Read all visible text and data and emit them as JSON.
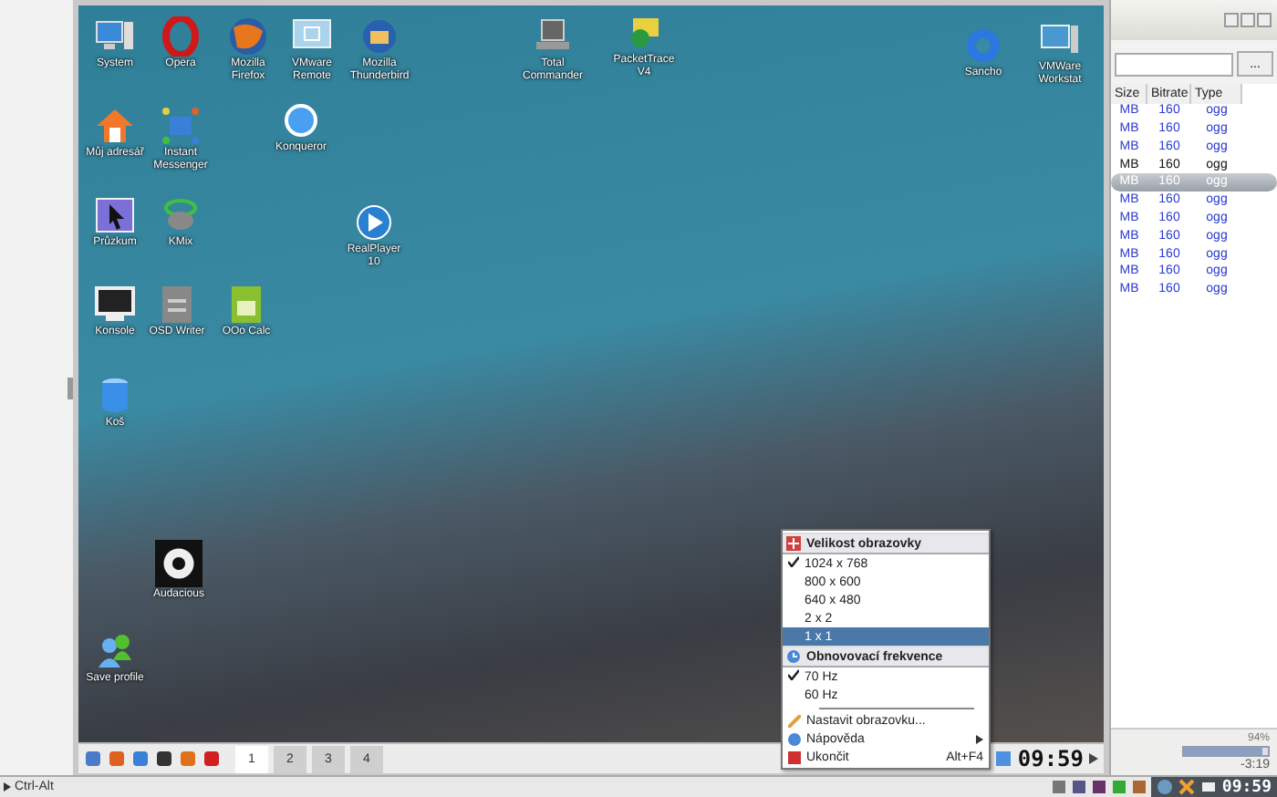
{
  "desktop": {
    "icons": [
      {
        "label": "System"
      },
      {
        "label": "Opera"
      },
      {
        "label": "Mozilla Firefox"
      },
      {
        "label": "VMware Remote"
      },
      {
        "label": "Mozilla Thunderbird"
      },
      {
        "label": "Total Commander"
      },
      {
        "label": "PacketTrace V4"
      },
      {
        "label": "Sancho"
      },
      {
        "label": "VMWare Workstat"
      },
      {
        "label": "Můj adresář"
      },
      {
        "label": "Instant Messenger"
      },
      {
        "label": "Konqueror"
      },
      {
        "label": "Průzkum"
      },
      {
        "label": "KMix"
      },
      {
        "label": "RealPlayer 10"
      },
      {
        "label": "Konsole"
      },
      {
        "label": "OSD Writer"
      },
      {
        "label": "OOo Calc"
      },
      {
        "label": "Koš"
      },
      {
        "label": "Audacious"
      },
      {
        "label": "Save profile"
      }
    ]
  },
  "menu": {
    "sections": [
      {
        "title": "Velikost obrazovky",
        "items": [
          {
            "label": "1024 x 768",
            "checked": true,
            "selected": false
          },
          {
            "label": "800 x 600",
            "checked": false,
            "selected": false
          },
          {
            "label": "640 x 480",
            "checked": false,
            "selected": false
          },
          {
            "label": "2 x 2",
            "checked": false,
            "selected": false
          },
          {
            "label": "1 x 1",
            "checked": false,
            "selected": true
          }
        ]
      },
      {
        "title": "Obnovovací frekvence",
        "items": [
          {
            "label": "70 Hz",
            "checked": true,
            "selected": false
          },
          {
            "label": "60 Hz",
            "checked": false,
            "selected": false
          }
        ]
      }
    ],
    "actions": [
      {
        "label": "Nastavit obrazovku...",
        "submenu": false
      },
      {
        "label": "Nápověda",
        "submenu": true
      },
      {
        "label": "Ukončit",
        "shortcut": "Alt+F4",
        "submenu": false
      }
    ]
  },
  "taskbar": {
    "desktops": [
      {
        "label": "1",
        "selected": true
      },
      {
        "label": "2",
        "selected": false
      },
      {
        "label": "3",
        "selected": false
      },
      {
        "label": "4",
        "selected": false
      }
    ],
    "clock": "09:59"
  },
  "player": {
    "browse_button": "...",
    "table": {
      "columns": [
        "Size",
        "Bitrate",
        "Type"
      ],
      "rows": [
        {
          "cells": [
            "MB",
            "160",
            "ogg"
          ],
          "selected": false,
          "playing": false
        },
        {
          "cells": [
            "MB",
            "160",
            "ogg"
          ],
          "selected": false,
          "playing": false
        },
        {
          "cells": [
            "MB",
            "160",
            "ogg"
          ],
          "selected": false,
          "playing": false
        },
        {
          "cells": [
            "MB",
            "160",
            "ogg"
          ],
          "selected": false,
          "playing": true
        },
        {
          "cells": [
            "MB",
            "160",
            "ogg"
          ],
          "selected": true,
          "playing": false
        },
        {
          "cells": [
            "MB",
            "160",
            "ogg"
          ],
          "selected": false,
          "playing": false
        },
        {
          "cells": [
            "MB",
            "160",
            "ogg"
          ],
          "selected": false,
          "playing": false
        },
        {
          "cells": [
            "MB",
            "160",
            "ogg"
          ],
          "selected": false,
          "playing": false
        },
        {
          "cells": [
            "MB",
            "160",
            "ogg"
          ],
          "selected": false,
          "playing": false
        },
        {
          "cells": [
            "MB",
            "160",
            "ogg"
          ],
          "selected": false,
          "playing": false
        },
        {
          "cells": [
            "MB",
            "160",
            "ogg"
          ],
          "selected": false,
          "playing": false
        }
      ]
    },
    "volume": {
      "reading": "94%",
      "level": 0.94
    },
    "time": "-3:19"
  },
  "host_bar": {
    "hint": "Ctrl-Alt",
    "clock": "09:59"
  }
}
